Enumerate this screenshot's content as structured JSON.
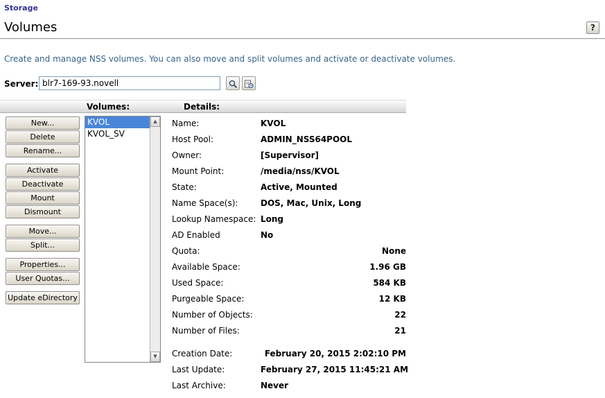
{
  "breadcrumb": {
    "label": "Storage"
  },
  "page": {
    "title": "Volumes",
    "help_label": "?"
  },
  "description": "Create and manage NSS volumes. You can also move and split volumes and activate or deactivate volumes.",
  "server": {
    "label": "Server:",
    "value": "blr7-169-93.novell"
  },
  "panel": {
    "volumes_header": "Volumes:",
    "details_header": "Details:"
  },
  "buttons": {
    "new": "New...",
    "delete": "Delete",
    "rename": "Rename...",
    "activate": "Activate",
    "deactivate": "Deactivate",
    "mount": "Mount",
    "dismount": "Dismount",
    "move": "Move...",
    "split": "Split...",
    "properties": "Properties...",
    "user_quotas": "User Quotas...",
    "update_edirectory": "Update eDirectory"
  },
  "volumes": [
    {
      "name": "KVOL",
      "selected": true
    },
    {
      "name": "KVOL_SV",
      "selected": false
    }
  ],
  "details": {
    "rows": [
      {
        "label": "Name:",
        "value": "KVOL",
        "align": "left"
      },
      {
        "label": "Host Pool:",
        "value": "ADMIN_NSS64POOL",
        "align": "left"
      },
      {
        "label": "Owner:",
        "value": "[Supervisor]",
        "align": "left"
      },
      {
        "label": "Mount Point:",
        "value": "/media/nss/KVOL",
        "align": "left"
      },
      {
        "label": "State:",
        "value": "Active, Mounted",
        "align": "left"
      },
      {
        "label": "Name Space(s):",
        "value": "DOS, Mac, Unix, Long",
        "align": "left"
      },
      {
        "label": "Lookup Namespace:",
        "value": "Long",
        "align": "left"
      },
      {
        "label": "AD Enabled",
        "value": "No",
        "align": "left"
      },
      {
        "label": "Quota:",
        "value": "None",
        "align": "right"
      },
      {
        "label": "Available Space:",
        "value": "1.96 GB",
        "align": "right"
      },
      {
        "label": "Used Space:",
        "value": "584 KB",
        "align": "right"
      },
      {
        "label": "Purgeable Space:",
        "value": "12 KB",
        "align": "right"
      },
      {
        "label": "Number of Objects:",
        "value": "22",
        "align": "right"
      },
      {
        "label": "Number of Files:",
        "value": "21",
        "align": "right"
      },
      {
        "label": "Creation Date:",
        "value": "February 20, 2015 2:02:10 PM",
        "align": "right"
      },
      {
        "label": "Last Update:",
        "value": "February 27, 2015 11:45:21 AM",
        "align": "right"
      },
      {
        "label": "Last Archive:",
        "value": "Never",
        "align": "left"
      }
    ]
  },
  "icons": {
    "scroll_up": "▲",
    "scroll_down": "▼",
    "object_selector": "magnifier",
    "object_history": "history"
  },
  "colors": {
    "selection": "#4a86d8",
    "description_text": "#36648b",
    "breadcrumb": "#333399",
    "button_face": "#e6e1d5"
  }
}
